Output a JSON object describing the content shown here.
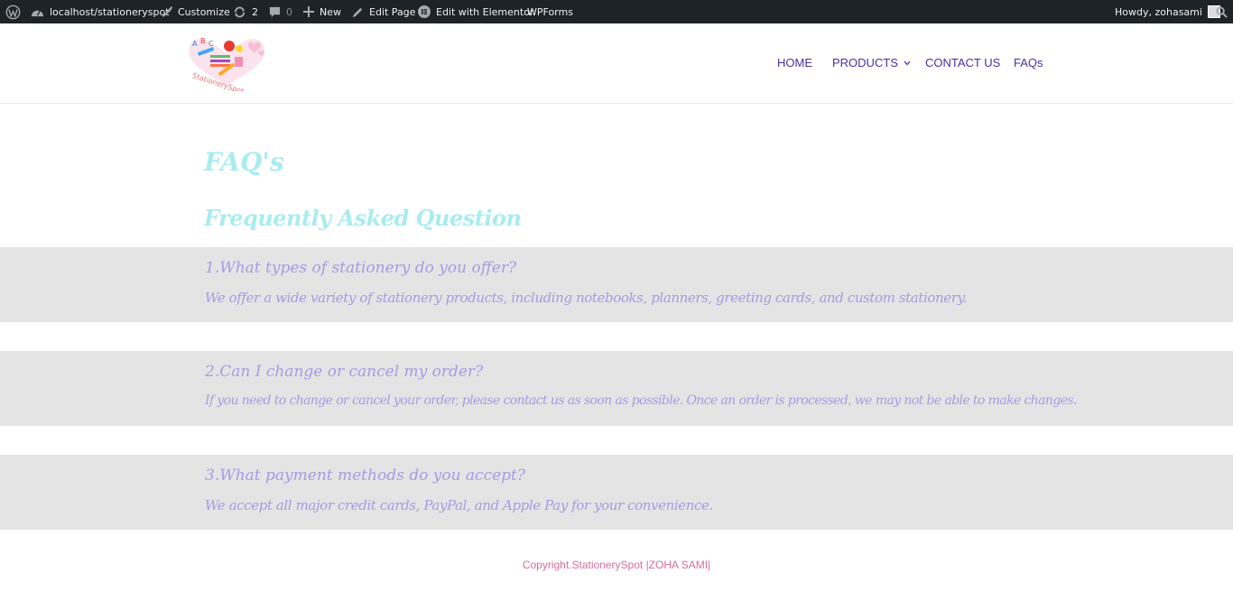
{
  "admin_bar": {
    "site_url": "localhost/stationeryspot",
    "customize": "Customize",
    "updates_count": "2",
    "comments_count": "0",
    "new": "New",
    "edit_page": "Edit Page",
    "edit_elementor": "Edit with Elementor",
    "wpforms": "WPForms",
    "howdy": "Howdy, zohasami"
  },
  "header": {
    "logo_text": "StationerySpot",
    "nav": {
      "home": "HOME",
      "products": "PRODUCTS",
      "contact": "CONTACT US",
      "faqs": "FAQs"
    }
  },
  "page": {
    "title": "FAQ's",
    "subtitle": "Frequently Asked Question",
    "faqs": [
      {
        "question": "1.What types of stationery do you offer?",
        "answer": "We offer a wide variety of stationery products, including notebooks, planners, greeting cards, and custom stationery."
      },
      {
        "question": "2.Can I change or cancel my order?",
        "answer": "If you need to change or cancel your order, please contact us as soon as possible. Once an order is processed, we may not be able to make changes."
      },
      {
        "question": "3.What payment methods do you accept?",
        "answer": "We accept all major credit cards, PayPal, and Apple Pay for your convenience."
      }
    ]
  },
  "footer": {
    "copyright": "Copyright.StationerySpot |ZOHA SAMI|"
  },
  "colors": {
    "admin_bar_bg": "#1d2327",
    "nav_text": "#4a2fa6",
    "title_color": "#a9ecef",
    "faq_text": "#a89be3",
    "faq_band": "#e4e4e4",
    "footer_text": "#d56d9f"
  },
  "icons": [
    "wordpress-icon",
    "brush-icon",
    "updates-icon",
    "comment-icon",
    "plus-icon",
    "pencil-icon",
    "elementor-icon",
    "search-icon",
    "chevron-down-icon"
  ]
}
